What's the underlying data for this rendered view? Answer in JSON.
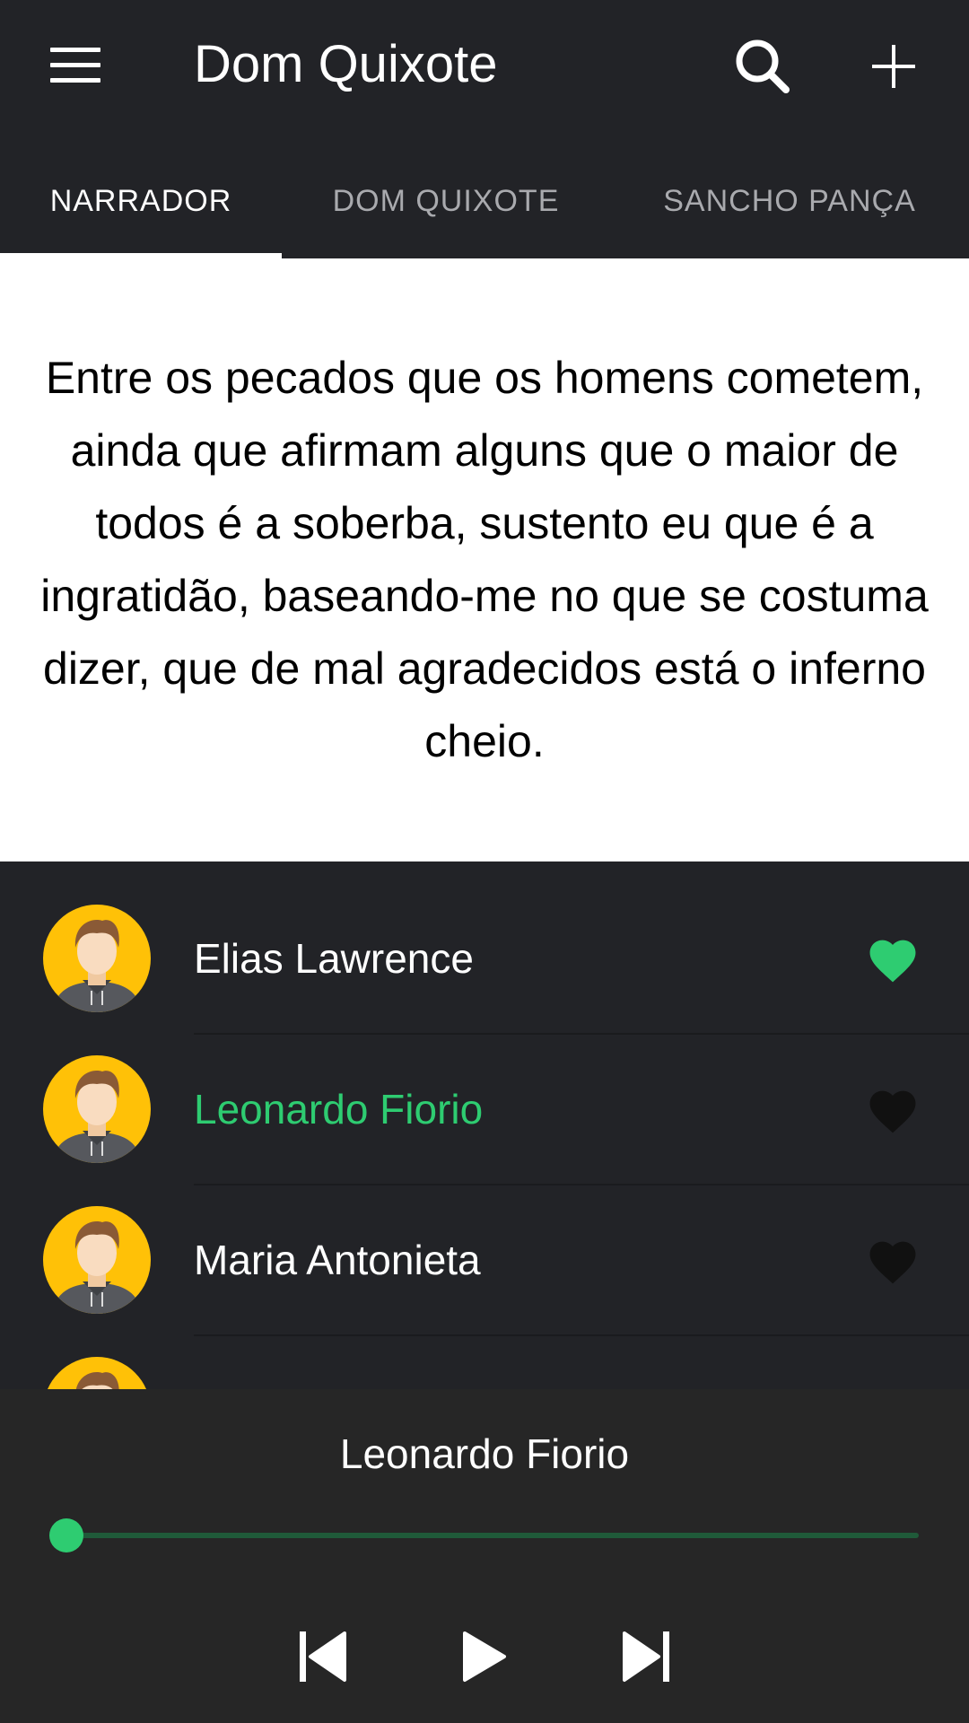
{
  "app_bar": {
    "title": "Dom Quixote",
    "icons": {
      "menu": "menu-icon",
      "search": "search-icon",
      "add": "plus-icon"
    }
  },
  "tabs": [
    {
      "label": "NARRADOR",
      "active": true
    },
    {
      "label": "DOM QUIXOTE",
      "active": false
    },
    {
      "label": "SANCHO PANÇA",
      "active": false
    }
  ],
  "quote": {
    "text": "Entre os pecados que os homens cometem, ainda que afirmam alguns que o maior de todos é a soberba, sustento eu que é a ingratidão, baseando-me no que se costuma dizer, que de mal agradecidos está o inferno cheio."
  },
  "list": {
    "items": [
      {
        "name": "Elias Lawrence",
        "favorite": true,
        "playing": false
      },
      {
        "name": "Leonardo Fiorio",
        "favorite": false,
        "playing": true
      },
      {
        "name": "Maria Antonieta",
        "favorite": false,
        "playing": false
      },
      {
        "name": "",
        "favorite": true,
        "playing": false
      }
    ]
  },
  "player": {
    "now_playing": "Leonardo Fiorio",
    "progress": 0.0,
    "controls": {
      "previous": "skip-previous-icon",
      "play": "play-icon",
      "next": "skip-next-icon"
    }
  },
  "colors": {
    "background": "#222327",
    "accent": "#2ecc71",
    "favorite_off": "#111111",
    "avatar_bg": "#ffc107",
    "player_bg": "#262626",
    "card_bg": "#ffffff"
  }
}
